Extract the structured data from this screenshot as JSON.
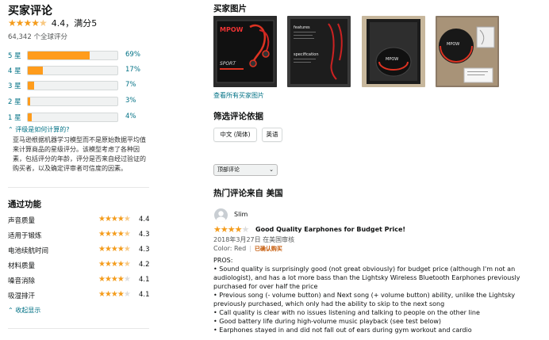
{
  "summary": {
    "title": "买家评论",
    "rating_text": "4.4，满分5",
    "rating_value": 4.4,
    "global_count": "64,342 个全球评分",
    "histogram": [
      {
        "label": "5 星",
        "percent": 69,
        "percent_text": "69%"
      },
      {
        "label": "4 星",
        "percent": 17,
        "percent_text": "17%"
      },
      {
        "label": "3 星",
        "percent": 7,
        "percent_text": "7%"
      },
      {
        "label": "2 星",
        "percent": 3,
        "percent_text": "3%"
      },
      {
        "label": "1 星",
        "percent": 4,
        "percent_text": "4%"
      }
    ],
    "how_link": "评级是如何计算的?",
    "explain": "亚马逊根据机器学习模型而不是原始数据平均值来计算商品的星级评分。该模型考虑了各种因素，包括评分的年龄，评分是否来自经过验证的购买者，以及确定评审者可信度的因素。"
  },
  "features": {
    "title": "通过功能",
    "items": [
      {
        "label": "声音质量",
        "value": "4.4"
      },
      {
        "label": "适用于锻炼",
        "value": "4.3"
      },
      {
        "label": "电池续航时间",
        "value": "4.3"
      },
      {
        "label": "材料质量",
        "value": "4.2"
      },
      {
        "label": "噪音消除",
        "value": "4.1"
      },
      {
        "label": "吸湿排汗",
        "value": "4.1"
      }
    ],
    "collapse": "收起显示"
  },
  "photos": {
    "title": "买家图片",
    "see_all": "查看所有买家图片",
    "items": [
      {
        "alt": "MPOW SPORT earphones box"
      },
      {
        "alt": "features specification box"
      },
      {
        "alt": "open box with earphones case"
      },
      {
        "alt": "case with earphones and manual"
      }
    ],
    "brand_text": "MPOW",
    "box_sport": "SPORT",
    "box_features": "features",
    "box_spec": "specification"
  },
  "filter": {
    "title": "筛选评论依据",
    "lang_buttons": [
      "中文 (简体)",
      "英语"
    ],
    "sort": "顶部评论"
  },
  "top_reviews": {
    "title": "热门评论来自 美国",
    "review": {
      "name": "Slim",
      "stars": 4,
      "title": "Good Quality Earphones for Budget Price!",
      "date": "2018年3月27日 在美国审核",
      "color": "Color: Red",
      "verified": "已确认购买",
      "body": [
        "PROS:",
        "• Sound quality is surprisingly good (not great obviously) for budget price (although I'm not an audiologist), and has a lot more bass than the Lightsky Wireless Bluetooth Earphones previously purchased for over half the price",
        "• Previous song (- volume button) and Next song (+ volume button) ability, unlike the Lightsky previously purchased, which only had the ability to skip to the next song",
        "• Call quality is clear with no issues listening and talking to people on the other line",
        "• Good battery life during high-volume music playback (see test below)",
        "• Earphones stayed in and did not fall out of ears during gym workout and cardio"
      ]
    }
  },
  "colors": {
    "star": "#f49c1c",
    "bar_fill": "#ff9c1c",
    "link": "#007185",
    "verified": "#c45500"
  }
}
